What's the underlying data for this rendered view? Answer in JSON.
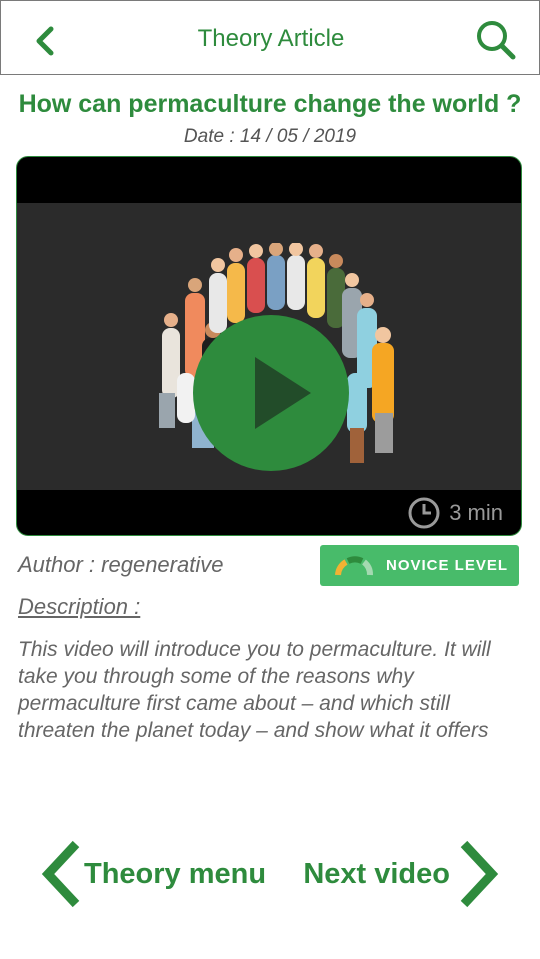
{
  "header": {
    "title": "Theory Article",
    "back_icon": "chevron-left-icon",
    "search_icon": "search-icon"
  },
  "article": {
    "title": "How can permaculture change the world ?",
    "date": "Date : 14 / 05 / 2019"
  },
  "video": {
    "duration": "3 min",
    "play_icon": "play-icon",
    "clock_icon": "clock-icon"
  },
  "meta": {
    "author": "Author : regenerative",
    "level": "NOVICE LEVEL"
  },
  "description": {
    "label": "Description :",
    "text": "This video will introduce you to permaculture. It will take you through some of the reasons why permaculture first came about – and which still threaten the planet today – and show what it offers"
  },
  "footer": {
    "prev_label": "Theory menu",
    "next_label": "Next video"
  },
  "colors": {
    "accent": "#2e8b3d",
    "badge": "#48bb6a",
    "video_bg": "#2b2b2b"
  }
}
